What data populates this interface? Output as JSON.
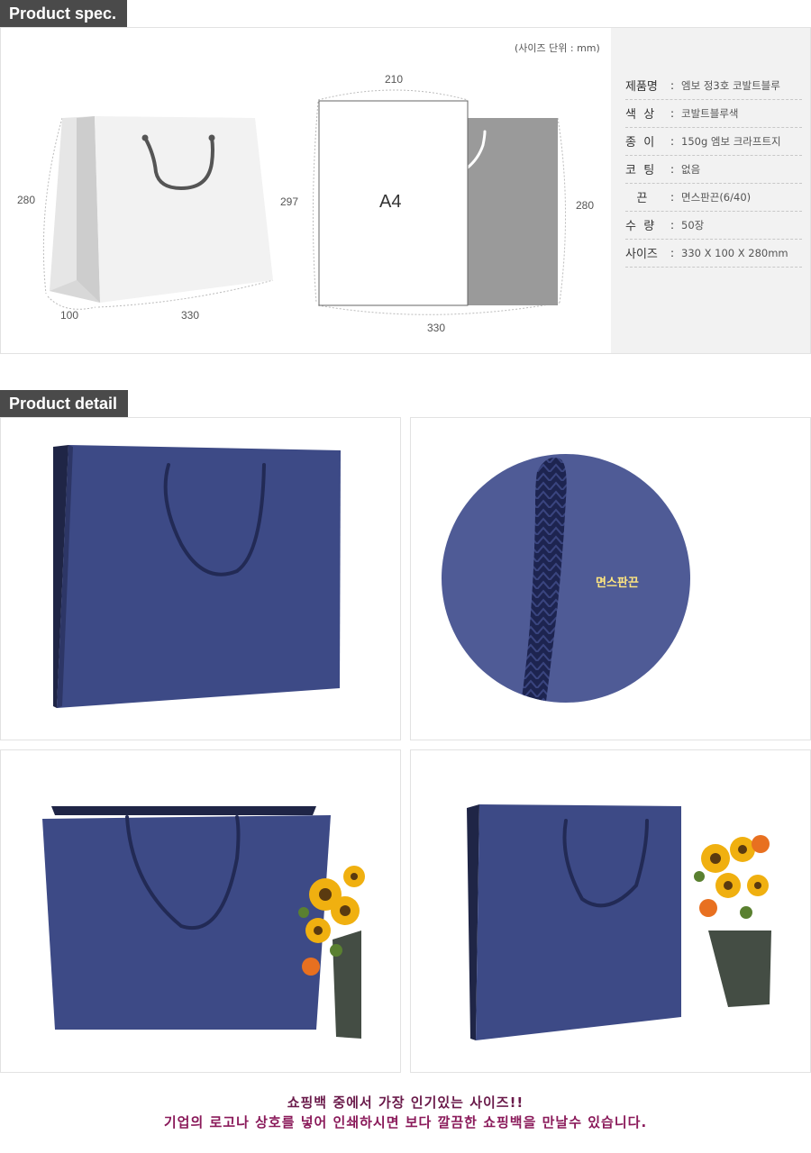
{
  "spec_section": {
    "title": "Product spec."
  },
  "unit_note": "(사이즈 단위 : mm)",
  "drawing": {
    "bag_height": "280",
    "bag_gusset": "100",
    "bag_width": "330",
    "a4_width": "210",
    "a4_height": "297",
    "a4_label": "A4",
    "compare_height": "280",
    "compare_width": "330"
  },
  "specs": [
    {
      "key": "제품명",
      "value": "엠보 정3호 코발트블루"
    },
    {
      "key": "색  상",
      "value": "코발트블루색"
    },
    {
      "key": "종  이",
      "value": "150g 엠보 크라프트지"
    },
    {
      "key": "코  팅",
      "value": "없음"
    },
    {
      "key": "   끈",
      "value": "면스판끈(6/40)"
    },
    {
      "key": "수  량",
      "value": "50장"
    },
    {
      "key": "사이즈",
      "value": "330 X 100 X 280mm"
    }
  ],
  "detail_section": {
    "title": "Product detail"
  },
  "detail_callout": "면스판끈",
  "footer": {
    "line1": "쇼핑백 중에서 가장 인기있는 사이즈!!",
    "line2": "기업의 로고나 상호를 넣어 인쇄하시면 보다 깔끔한 쇼핑백을 만날수 있습니다."
  },
  "colors": {
    "tab": "#4a4a4a",
    "bag_blue": "#3d4a86",
    "footer_line1": "#6a1a4a",
    "footer_line2": "#8a1a5a"
  }
}
